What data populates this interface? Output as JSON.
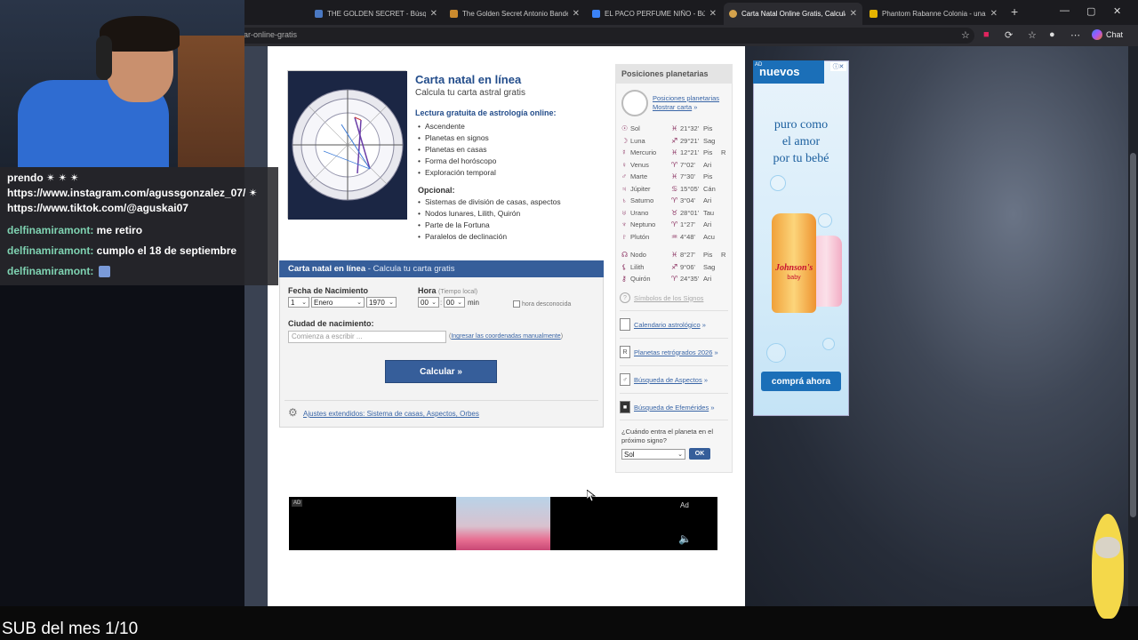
{
  "browser": {
    "tabs": [
      {
        "label": "THE GOLDEN SECRET - Búsqueda",
        "color": "#4a78c2"
      },
      {
        "label": "The Golden Secret Antonio Bande",
        "color": "#c98a2e"
      },
      {
        "label": "EL PACO PERFUME NIÑO - Búsqu",
        "color": "#3b82f6"
      },
      {
        "label": "Carta Natal Online Gratis, Calcula",
        "color": "#d4a24c"
      },
      {
        "label": "Phantom Rabanne Colonia - una",
        "color": "#e5b400"
      }
    ],
    "active_tab": 3,
    "url": "ar-online-gratis",
    "chat_label": "Chat",
    "win_min": "—",
    "win_max": "▢",
    "win_close": "✕",
    "new_tab": "+"
  },
  "main": {
    "title": "Carta natal en línea",
    "subtitle": "Calcula tu carta astral gratis",
    "lecture": "Lectura gratuita de astrología online:",
    "features": [
      "Ascendente",
      "Planetas en signos",
      "Planetas en casas",
      "Forma del horóscopo",
      "Exploración temporal"
    ],
    "optional_label": "Opcional:",
    "optional_features": [
      "Sistemas de división de casas, aspectos",
      "Nodos lunares, Lilith, Quirón",
      "Parte de la Fortuna",
      "Paralelos de declinación"
    ]
  },
  "form": {
    "header_bold": "Carta natal en línea",
    "header_light": " - Calcula tu carta gratis",
    "birth_date_label": "Fecha de Nacimiento",
    "day": "1",
    "month": "Enero",
    "year": "1970",
    "time_label": "Hora",
    "time_hint": "(Tiempo local)",
    "hour": "00",
    "minute": "00",
    "min_label": "min",
    "unknown_time": "hora desconocida",
    "city_label": "Ciudad de nacimiento:",
    "city_placeholder": "Comienza a escribir ...",
    "coords_link": "Ingresar las coordenadas manualmente",
    "calc_button": "Calcular »",
    "extended_settings": "Ajustes extendidos: Sistema de casas, Aspectos, Orbes"
  },
  "sidebar": {
    "header": "Posiciones planetarias",
    "pos_link": "Posiciones planetarias",
    "show_chart": "Mostrar carta",
    "planets": [
      {
        "glyph": "☉",
        "name": "Sol",
        "sign_glyph": "♓",
        "deg": "21°32'",
        "sign": "Pis",
        "r": ""
      },
      {
        "glyph": "☽",
        "name": "Luna",
        "sign_glyph": "♐",
        "deg": "29°21'",
        "sign": "Sag",
        "r": ""
      },
      {
        "glyph": "☿",
        "name": "Mercurio",
        "sign_glyph": "♓",
        "deg": "12°21'",
        "sign": "Pis",
        "r": "R"
      },
      {
        "glyph": "♀",
        "name": "Venus",
        "sign_glyph": "♈",
        "deg": "7°02'",
        "sign": "Ari",
        "r": ""
      },
      {
        "glyph": "♂",
        "name": "Marte",
        "sign_glyph": "♓",
        "deg": "7°30'",
        "sign": "Pis",
        "r": ""
      },
      {
        "glyph": "♃",
        "name": "Júpiter",
        "sign_glyph": "♋",
        "deg": "15°05'",
        "sign": "Cán",
        "r": ""
      },
      {
        "glyph": "♄",
        "name": "Saturno",
        "sign_glyph": "♈",
        "deg": "3°04'",
        "sign": "Ari",
        "r": ""
      },
      {
        "glyph": "♅",
        "name": "Urano",
        "sign_glyph": "♉",
        "deg": "28°01'",
        "sign": "Tau",
        "r": ""
      },
      {
        "glyph": "♆",
        "name": "Neptuno",
        "sign_glyph": "♈",
        "deg": "1°27'",
        "sign": "Ari",
        "r": ""
      },
      {
        "glyph": "♇",
        "name": "Plutón",
        "sign_glyph": "♒",
        "deg": "4°48'",
        "sign": "Acu",
        "r": ""
      }
    ],
    "points": [
      {
        "glyph": "☊",
        "name": "Nodo",
        "sign_glyph": "♓",
        "deg": "8°27'",
        "sign": "Pis",
        "r": "R"
      },
      {
        "glyph": "⚸",
        "name": "Lilith",
        "sign_glyph": "♐",
        "deg": "9°06'",
        "sign": "Sag",
        "r": ""
      },
      {
        "glyph": "⚷",
        "name": "Quirón",
        "sign_glyph": "♈",
        "deg": "24°35'",
        "sign": "Ari",
        "r": ""
      }
    ],
    "symbols_link": "Símbolos de los Signos",
    "links": [
      "Calendario astrológico",
      "Planetas retrógrados 2026",
      "Búsqueda de Aspectos",
      "Búsqueda de Efemérides"
    ],
    "question": "¿Cuándo entra el planeta en el próximo signo?",
    "planet_select": "Sol",
    "ok_button": "OK"
  },
  "ads": {
    "tag": "AD",
    "new_label": "nuevos",
    "lines": [
      "puro como",
      "el amor",
      "por tu bebé"
    ],
    "brand": "Johnson's",
    "brand_sub": "baby",
    "cta": "comprá ahora",
    "banner_tag": "AD",
    "banner_ad": "Ad"
  },
  "stream": {
    "chat": [
      {
        "user": "",
        "msg": "prendo ✴ ✴ ✴"
      },
      {
        "user": "",
        "msg": "https://www.instagram.com/agussgonzalez_07/ ✴"
      },
      {
        "user": "",
        "msg": "https://www.tiktok.com/@aguskai07"
      },
      {
        "user": "delfinamiramont:",
        "msg": " me retiro"
      },
      {
        "user": "delfinamiramont:",
        "msg": " cumplo el 18 de septiembre"
      },
      {
        "user": "delfinamiramont:",
        "msg": " "
      }
    ],
    "sub_text": "SUB del mes 1/10"
  }
}
